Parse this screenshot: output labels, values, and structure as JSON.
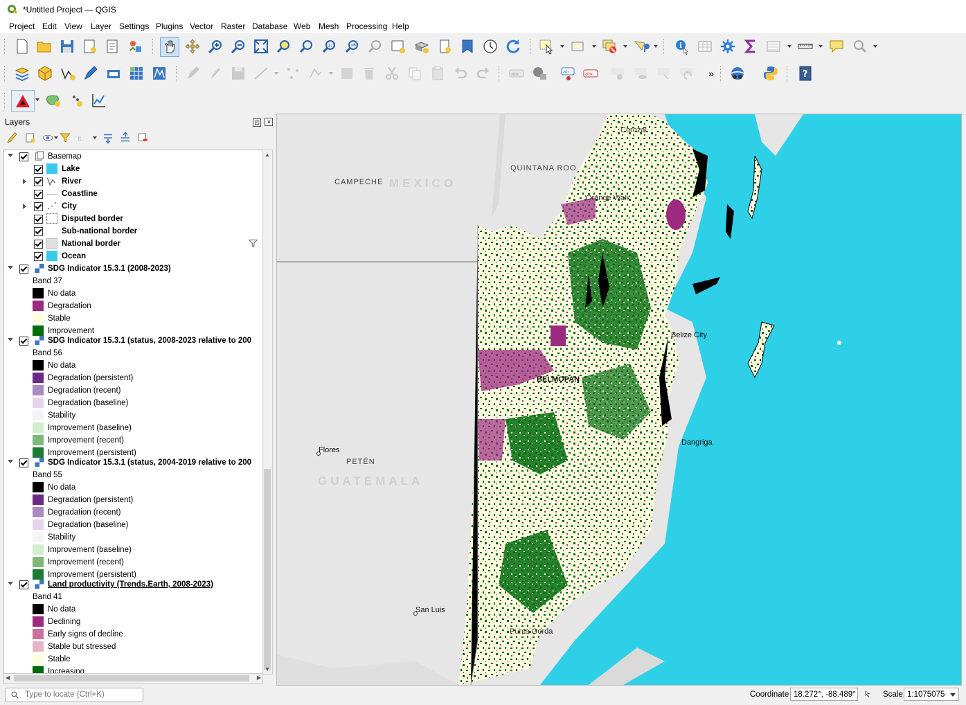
{
  "window": {
    "title": "*Untitled Project — QGIS"
  },
  "menu": [
    "Project",
    "Edit",
    "View",
    "Layer",
    "Settings",
    "Plugins",
    "Vector",
    "Raster",
    "Database",
    "Web",
    "Mesh",
    "Processing",
    "Help"
  ],
  "panel": {
    "title": "Layers"
  },
  "layers": {
    "basemap": {
      "name": "Basemap",
      "children": [
        "Lake",
        "River",
        "Coastline",
        "City",
        "Disputed border",
        "Sub-national border",
        "National border",
        "Ocean"
      ]
    },
    "sdg1": {
      "name": "SDG Indicator 15.3.1 (2008-2023)",
      "band": "Band 37",
      "classes": [
        "No data",
        "Degradation",
        "Stable",
        "Improvement"
      ]
    },
    "sdg2": {
      "name": "SDG Indicator 15.3.1 (status, 2008-2023 relative to 200",
      "band": "Band 56",
      "classes": [
        "No data",
        "Degradation (persistent)",
        "Degradation (recent)",
        "Degradation (baseline)",
        "Stability",
        "Improvement (baseline)",
        "Improvement (recent)",
        "Improvement (persistent)"
      ]
    },
    "sdg3": {
      "name": "SDG Indicator 15.3.1 (status, 2004-2019 relative to 200",
      "band": "Band 55",
      "classes": [
        "No data",
        "Degradation (persistent)",
        "Degradation (recent)",
        "Degradation (baseline)",
        "Stability",
        "Improvement (baseline)",
        "Improvement (recent)",
        "Improvement (persistent)"
      ]
    },
    "lp": {
      "name": "Land productivity (Trends.Earth, 2008-2023)",
      "band": "Band 41",
      "classes": [
        "No data",
        "Declining",
        "Early signs of decline",
        "Stable but stressed",
        "Stable",
        "Increasing"
      ]
    }
  },
  "map_labels": {
    "campeche": "CAMPECHE",
    "mexico": "MEXICO",
    "quintana_roo": "QUINTANA ROO",
    "peten": "PETÉN",
    "guatemala": "GUATEMALA",
    "belmopan": "BELMOPAN",
    "flores": "Flores",
    "san_luis": "San Luis",
    "belize_city": "Belize City",
    "dangriga": "Dangriga",
    "orange_walk": "Orange Walk",
    "corozal": "Corozal",
    "punta_gorda": "Punta Gorda"
  },
  "status": {
    "locate_placeholder": "Type to locate (Ctrl+K)",
    "coordinate_label": "Coordinate",
    "coordinate_value": "18.272°, -88.489°",
    "scale_label": "Scale",
    "scale_value": "1:1075075"
  },
  "colors": {
    "ocean": "#2ed0e8",
    "lake": "#3ac8ee",
    "degradation": "#9b2a80",
    "stable": "#fffde0",
    "improvement": "#006b0c"
  }
}
